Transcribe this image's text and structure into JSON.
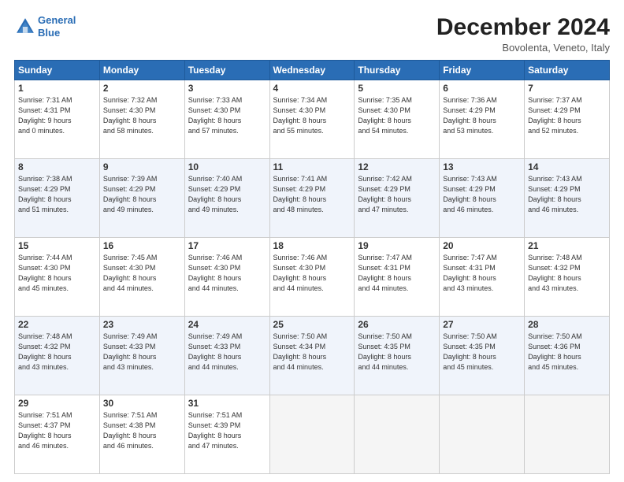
{
  "header": {
    "logo_line1": "General",
    "logo_line2": "Blue",
    "month_title": "December 2024",
    "location": "Bovolenta, Veneto, Italy"
  },
  "weekdays": [
    "Sunday",
    "Monday",
    "Tuesday",
    "Wednesday",
    "Thursday",
    "Friday",
    "Saturday"
  ],
  "weeks": [
    [
      {
        "day": "1",
        "info": "Sunrise: 7:31 AM\nSunset: 4:31 PM\nDaylight: 9 hours\nand 0 minutes."
      },
      {
        "day": "2",
        "info": "Sunrise: 7:32 AM\nSunset: 4:30 PM\nDaylight: 8 hours\nand 58 minutes."
      },
      {
        "day": "3",
        "info": "Sunrise: 7:33 AM\nSunset: 4:30 PM\nDaylight: 8 hours\nand 57 minutes."
      },
      {
        "day": "4",
        "info": "Sunrise: 7:34 AM\nSunset: 4:30 PM\nDaylight: 8 hours\nand 55 minutes."
      },
      {
        "day": "5",
        "info": "Sunrise: 7:35 AM\nSunset: 4:30 PM\nDaylight: 8 hours\nand 54 minutes."
      },
      {
        "day": "6",
        "info": "Sunrise: 7:36 AM\nSunset: 4:29 PM\nDaylight: 8 hours\nand 53 minutes."
      },
      {
        "day": "7",
        "info": "Sunrise: 7:37 AM\nSunset: 4:29 PM\nDaylight: 8 hours\nand 52 minutes."
      }
    ],
    [
      {
        "day": "8",
        "info": "Sunrise: 7:38 AM\nSunset: 4:29 PM\nDaylight: 8 hours\nand 51 minutes."
      },
      {
        "day": "9",
        "info": "Sunrise: 7:39 AM\nSunset: 4:29 PM\nDaylight: 8 hours\nand 49 minutes."
      },
      {
        "day": "10",
        "info": "Sunrise: 7:40 AM\nSunset: 4:29 PM\nDaylight: 8 hours\nand 49 minutes."
      },
      {
        "day": "11",
        "info": "Sunrise: 7:41 AM\nSunset: 4:29 PM\nDaylight: 8 hours\nand 48 minutes."
      },
      {
        "day": "12",
        "info": "Sunrise: 7:42 AM\nSunset: 4:29 PM\nDaylight: 8 hours\nand 47 minutes."
      },
      {
        "day": "13",
        "info": "Sunrise: 7:43 AM\nSunset: 4:29 PM\nDaylight: 8 hours\nand 46 minutes."
      },
      {
        "day": "14",
        "info": "Sunrise: 7:43 AM\nSunset: 4:29 PM\nDaylight: 8 hours\nand 46 minutes."
      }
    ],
    [
      {
        "day": "15",
        "info": "Sunrise: 7:44 AM\nSunset: 4:30 PM\nDaylight: 8 hours\nand 45 minutes."
      },
      {
        "day": "16",
        "info": "Sunrise: 7:45 AM\nSunset: 4:30 PM\nDaylight: 8 hours\nand 44 minutes."
      },
      {
        "day": "17",
        "info": "Sunrise: 7:46 AM\nSunset: 4:30 PM\nDaylight: 8 hours\nand 44 minutes."
      },
      {
        "day": "18",
        "info": "Sunrise: 7:46 AM\nSunset: 4:30 PM\nDaylight: 8 hours\nand 44 minutes."
      },
      {
        "day": "19",
        "info": "Sunrise: 7:47 AM\nSunset: 4:31 PM\nDaylight: 8 hours\nand 44 minutes."
      },
      {
        "day": "20",
        "info": "Sunrise: 7:47 AM\nSunset: 4:31 PM\nDaylight: 8 hours\nand 43 minutes."
      },
      {
        "day": "21",
        "info": "Sunrise: 7:48 AM\nSunset: 4:32 PM\nDaylight: 8 hours\nand 43 minutes."
      }
    ],
    [
      {
        "day": "22",
        "info": "Sunrise: 7:48 AM\nSunset: 4:32 PM\nDaylight: 8 hours\nand 43 minutes."
      },
      {
        "day": "23",
        "info": "Sunrise: 7:49 AM\nSunset: 4:33 PM\nDaylight: 8 hours\nand 43 minutes."
      },
      {
        "day": "24",
        "info": "Sunrise: 7:49 AM\nSunset: 4:33 PM\nDaylight: 8 hours\nand 44 minutes."
      },
      {
        "day": "25",
        "info": "Sunrise: 7:50 AM\nSunset: 4:34 PM\nDaylight: 8 hours\nand 44 minutes."
      },
      {
        "day": "26",
        "info": "Sunrise: 7:50 AM\nSunset: 4:35 PM\nDaylight: 8 hours\nand 44 minutes."
      },
      {
        "day": "27",
        "info": "Sunrise: 7:50 AM\nSunset: 4:35 PM\nDaylight: 8 hours\nand 45 minutes."
      },
      {
        "day": "28",
        "info": "Sunrise: 7:50 AM\nSunset: 4:36 PM\nDaylight: 8 hours\nand 45 minutes."
      }
    ],
    [
      {
        "day": "29",
        "info": "Sunrise: 7:51 AM\nSunset: 4:37 PM\nDaylight: 8 hours\nand 46 minutes."
      },
      {
        "day": "30",
        "info": "Sunrise: 7:51 AM\nSunset: 4:38 PM\nDaylight: 8 hours\nand 46 minutes."
      },
      {
        "day": "31",
        "info": "Sunrise: 7:51 AM\nSunset: 4:39 PM\nDaylight: 8 hours\nand 47 minutes."
      },
      {
        "day": "",
        "info": ""
      },
      {
        "day": "",
        "info": ""
      },
      {
        "day": "",
        "info": ""
      },
      {
        "day": "",
        "info": ""
      }
    ]
  ]
}
